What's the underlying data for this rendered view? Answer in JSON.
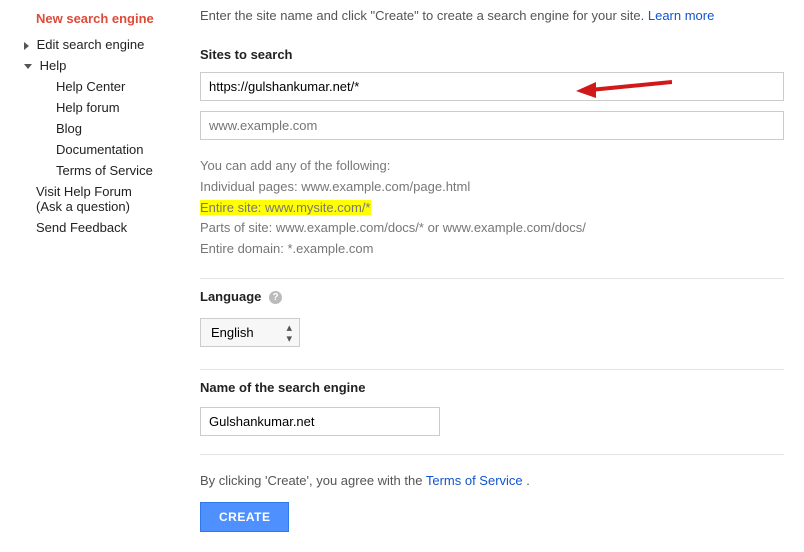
{
  "sidebar": {
    "new_engine": "New search engine",
    "edit_engine": "Edit search engine",
    "help_header": "Help",
    "help_items": [
      "Help Center",
      "Help forum",
      "Blog",
      "Documentation",
      "Terms of Service"
    ],
    "visit_forum_line1": "Visit Help Forum",
    "visit_forum_line2": "(Ask a question)",
    "send_feedback": "Send Feedback"
  },
  "intro": {
    "text": "Enter the site name and click \"Create\" to create a search engine for your site. ",
    "link": "Learn more"
  },
  "sites": {
    "label": "Sites to search",
    "value": "https://gulshankumar.net/*",
    "placeholder": "www.example.com",
    "help_intro": "You can add any of the following:",
    "rows": {
      "individual_label": "Individual pages:",
      "individual_val": " www.example.com/page.html",
      "entire_site_label": "Entire site:",
      "entire_site_val": " www.mysite.com/* ",
      "parts_label": "Parts of site:",
      "parts_val": " www.example.com/docs/* or www.example.com/docs/",
      "domain_label": "Entire domain:",
      "domain_val": " *.example.com"
    }
  },
  "language": {
    "label": "Language",
    "selected": "English"
  },
  "name": {
    "label": "Name of the search engine",
    "value": "Gulshankumar.net"
  },
  "footer": {
    "agree_pre": "By clicking 'Create', you agree with the ",
    "tos": "Terms of Service",
    "agree_post": " .",
    "button": "CREATE"
  }
}
